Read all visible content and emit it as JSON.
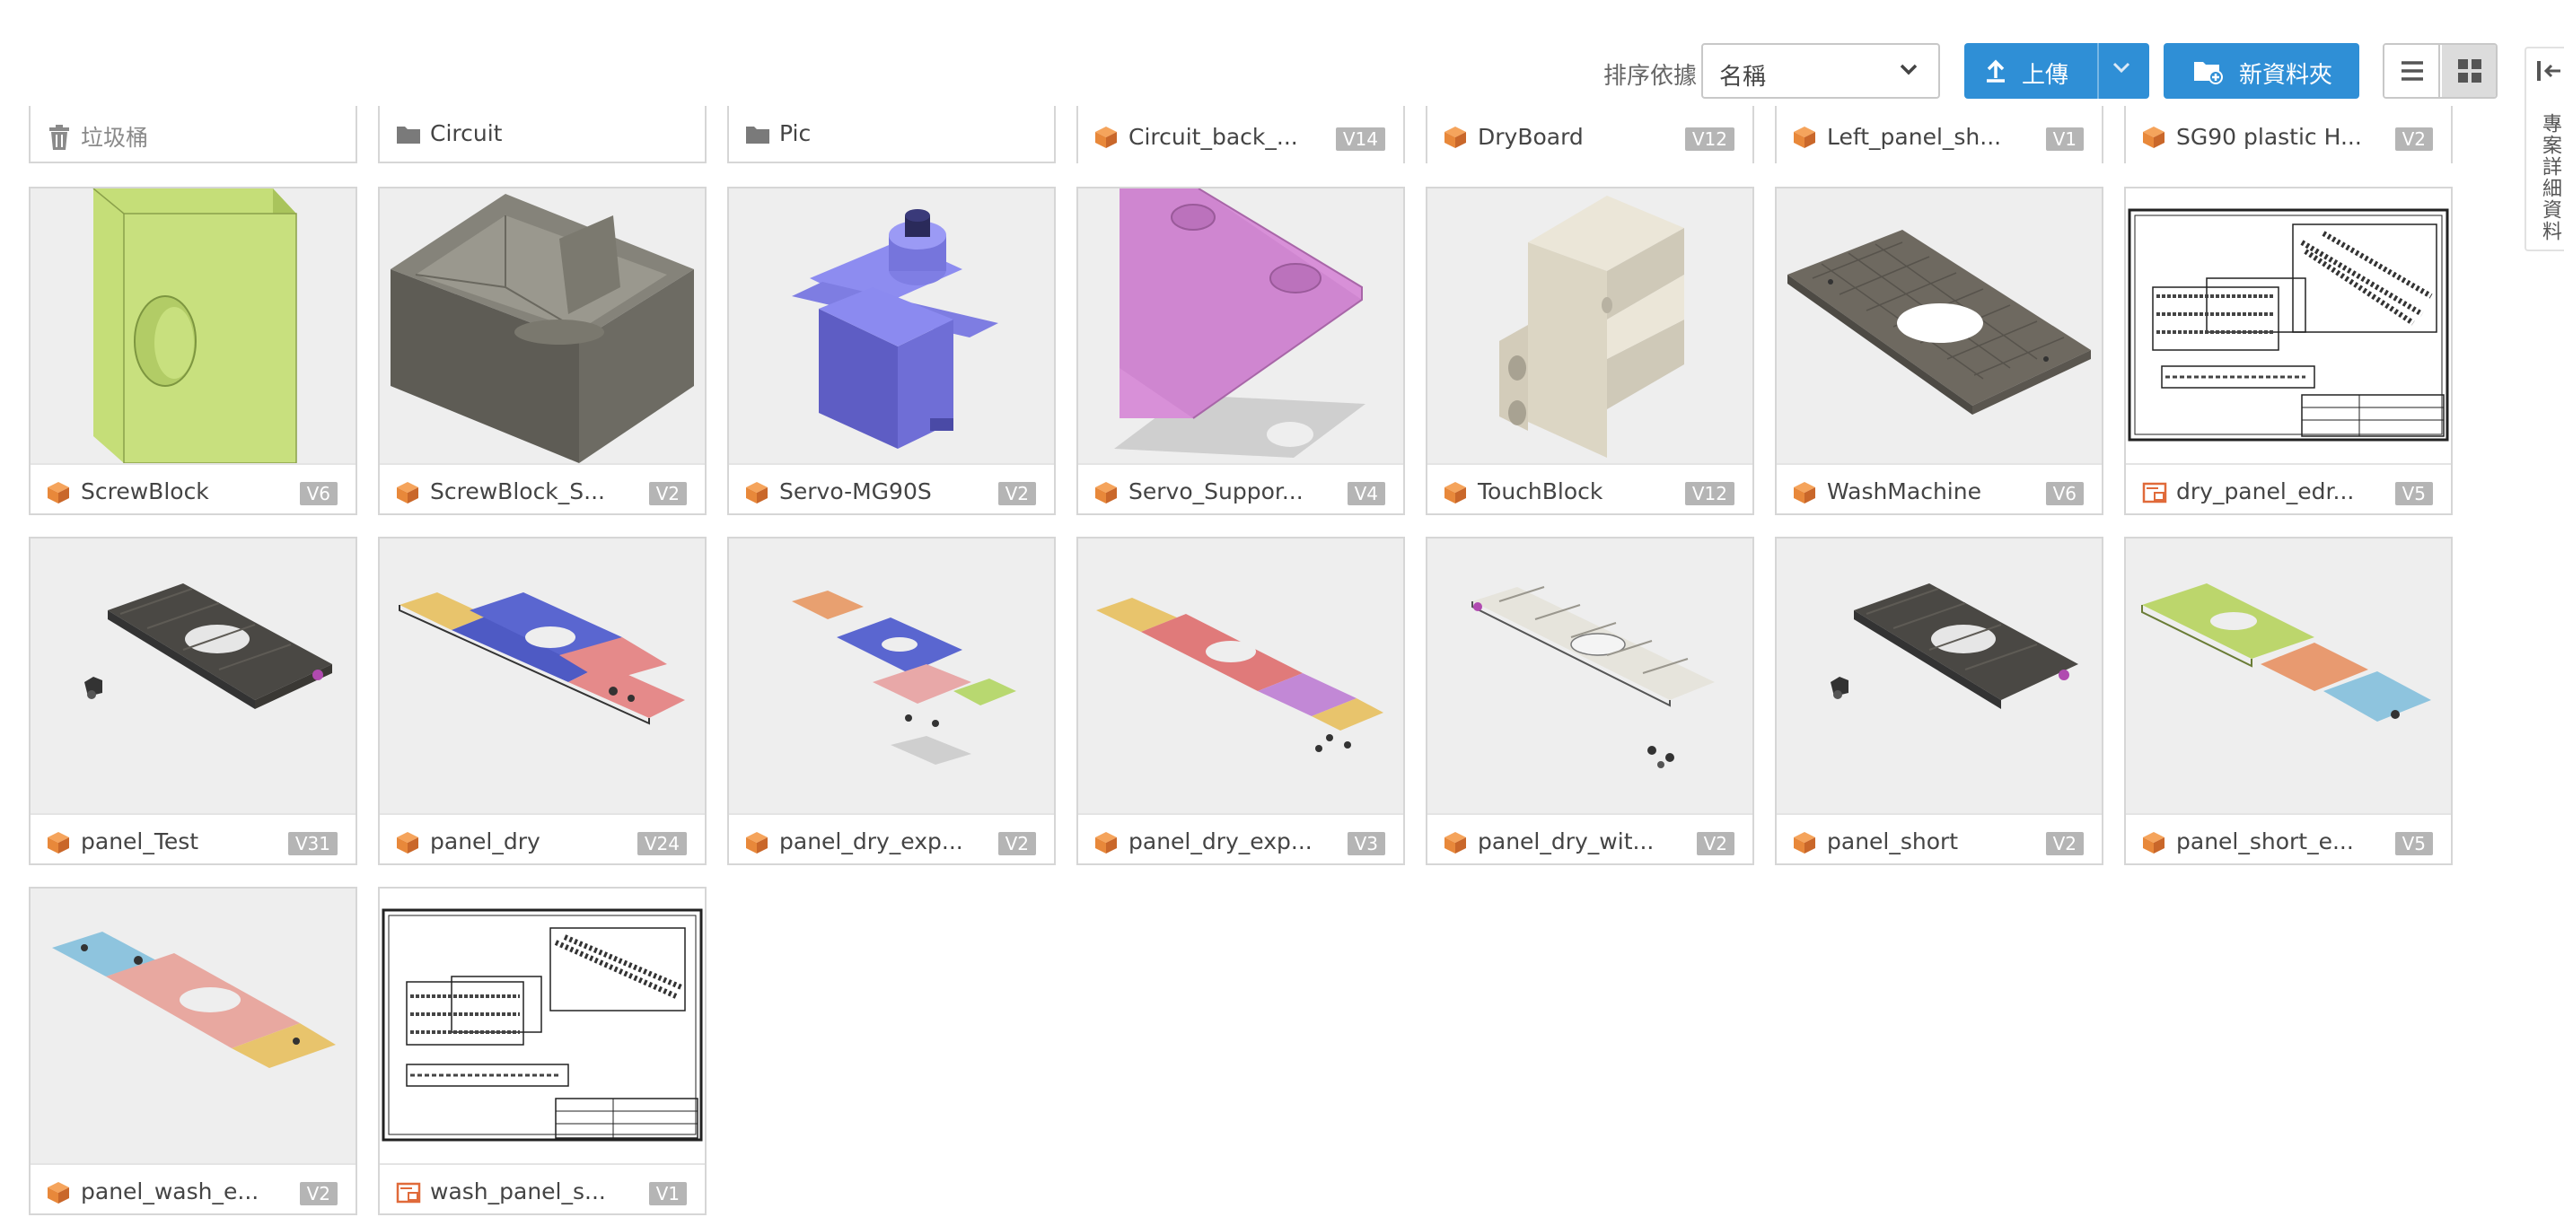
{
  "toolbar": {
    "sort_label": "排序依據",
    "sort_value": "名稱",
    "upload_label": "上傳",
    "new_folder_label": "新資料夾"
  },
  "side_panel": {
    "label": "專案詳細資料"
  },
  "top_row": [
    {
      "name": "垃圾桶",
      "kind": "trash"
    },
    {
      "name": "Circuit",
      "kind": "folder"
    },
    {
      "name": "Pic",
      "kind": "folder"
    },
    {
      "name": "Circuit_back_...",
      "kind": "model",
      "version": "V14"
    },
    {
      "name": "DryBoard",
      "kind": "model",
      "version": "V12"
    },
    {
      "name": "Left_panel_sh...",
      "kind": "model",
      "version": "V1"
    },
    {
      "name": "SG90 plastic H...",
      "kind": "model",
      "version": "V2"
    }
  ],
  "files": [
    {
      "name": "ScrewBlock",
      "kind": "model",
      "version": "V6"
    },
    {
      "name": "ScrewBlock_S...",
      "kind": "model",
      "version": "V2"
    },
    {
      "name": "Servo-MG90S",
      "kind": "model",
      "version": "V2"
    },
    {
      "name": "Servo_Suppor...",
      "kind": "model",
      "version": "V4"
    },
    {
      "name": "TouchBlock",
      "kind": "model",
      "version": "V12"
    },
    {
      "name": "WashMachine",
      "kind": "model",
      "version": "V6"
    },
    {
      "name": "dry_panel_edr...",
      "kind": "drawing",
      "version": "V5"
    },
    {
      "name": "panel_Test",
      "kind": "model",
      "version": "V31"
    },
    {
      "name": "panel_dry",
      "kind": "model",
      "version": "V24"
    },
    {
      "name": "panel_dry_exp...",
      "kind": "model",
      "version": "V2"
    },
    {
      "name": "panel_dry_exp...",
      "kind": "model",
      "version": "V3"
    },
    {
      "name": "panel_dry_wit...",
      "kind": "model",
      "version": "V2"
    },
    {
      "name": "panel_short",
      "kind": "model",
      "version": "V2"
    },
    {
      "name": "panel_short_e...",
      "kind": "model",
      "version": "V5"
    },
    {
      "name": "panel_wash_e...",
      "kind": "model",
      "version": "V2"
    },
    {
      "name": "wash_panel_s...",
      "kind": "drawing",
      "version": "V1"
    }
  ],
  "colors": {
    "accent": "#2f8fd6",
    "model_icon": "#e8883a",
    "drawing_icon": "#e06a3a",
    "version_badge": "#b5b5b5"
  }
}
